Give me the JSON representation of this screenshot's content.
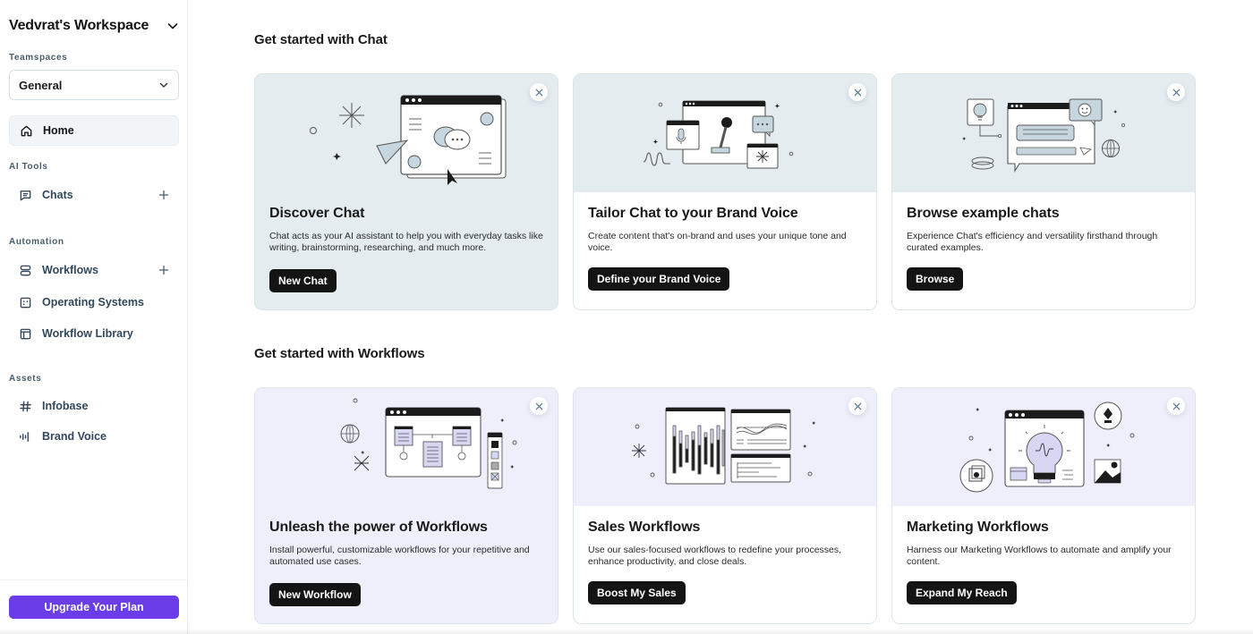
{
  "sidebar": {
    "workspace_title": "Vedvrat's Workspace",
    "teamspaces_label": "Teamspaces",
    "teamspace_selected": "General",
    "home_label": "Home",
    "ai_tools_label": "AI Tools",
    "chats_label": "Chats",
    "automation_label": "Automation",
    "workflows_label": "Workflows",
    "operating_systems_label": "Operating Systems",
    "workflow_library_label": "Workflow Library",
    "assets_label": "Assets",
    "infobase_label": "Infobase",
    "brand_voice_label": "Brand Voice",
    "upgrade_label": "Upgrade Your Plan"
  },
  "main": {
    "chat_section_title": "Get started with Chat",
    "workflows_section_title": "Get started with Workflows",
    "chat_cards": [
      {
        "title": "Discover Chat",
        "description": "Chat acts as your AI assistant to help you with everyday tasks like writing, brainstorming, researching, and much more.",
        "button": "New Chat"
      },
      {
        "title": "Tailor Chat to your Brand Voice",
        "description": "Create content that's on-brand and uses your unique tone and voice.",
        "button": "Define your Brand Voice"
      },
      {
        "title": "Browse example chats",
        "description": "Experience Chat's efficiency and versatility firsthand through curated examples.",
        "button": "Browse"
      }
    ],
    "workflow_cards": [
      {
        "title": "Unleash the power of Workflows",
        "description": "Install powerful, customizable workflows for your repetitive and automated use cases.",
        "button": "New Workflow"
      },
      {
        "title": "Sales Workflows",
        "description": "Use our sales-focused workflows to redefine your processes, enhance productivity, and close deals.",
        "button": "Boost My Sales"
      },
      {
        "title": "Marketing Workflows",
        "description": "Harness our Marketing Workflows to automate and amplify your content.",
        "button": "Expand My Reach"
      }
    ]
  },
  "colors": {
    "accent_purple": "#6a3de8",
    "chat_tint": "#e4ecf0",
    "workflow_tint": "#efeffb",
    "button_dark": "#141414"
  }
}
